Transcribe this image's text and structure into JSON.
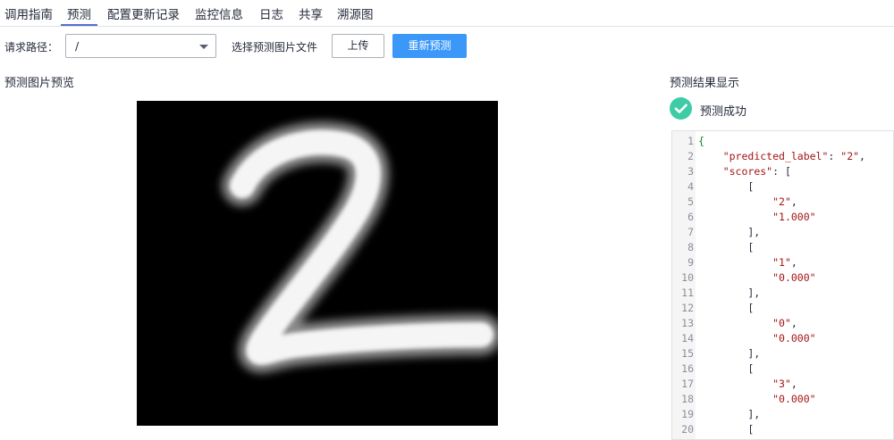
{
  "tabs": [
    {
      "label": "调用指南"
    },
    {
      "label": "预测"
    },
    {
      "label": "配置更新记录"
    },
    {
      "label": "监控信息"
    },
    {
      "label": "日志"
    },
    {
      "label": "共享"
    },
    {
      "label": "溯源图"
    }
  ],
  "active_tab": "预测",
  "request": {
    "path_label": "请求路径：",
    "path_value": "/",
    "choose_file_label": "选择预测图片文件",
    "upload_button": "上传",
    "repredict_button": "重新预测"
  },
  "preview": {
    "title": "预测图片预览",
    "image_description_icon": "handwritten-digit-image"
  },
  "result": {
    "title": "预测结果显示",
    "status": "预测成功",
    "status_color": "#3dcca6",
    "lines": [
      "{",
      "    \"predicted_label\": \"2\",",
      "    \"scores\": [",
      "        [",
      "            \"2\",",
      "            \"1.000\"",
      "        ],",
      "        [",
      "            \"1\",",
      "            \"0.000\"",
      "        ],",
      "        [",
      "            \"0\",",
      "            \"0.000\"",
      "        ],",
      "        [",
      "            \"3\",",
      "            \"0.000\"",
      "        ],",
      "        ["
    ],
    "line_numbers": [
      "1",
      "2",
      "3",
      "4",
      "5",
      "6",
      "7",
      "8",
      "9",
      "10",
      "11",
      "12",
      "13",
      "14",
      "15",
      "16",
      "17",
      "18",
      "19",
      "20"
    ]
  },
  "colors": {
    "primary_button": "#3b98f9",
    "active_tab_underline": "#526ecc"
  }
}
